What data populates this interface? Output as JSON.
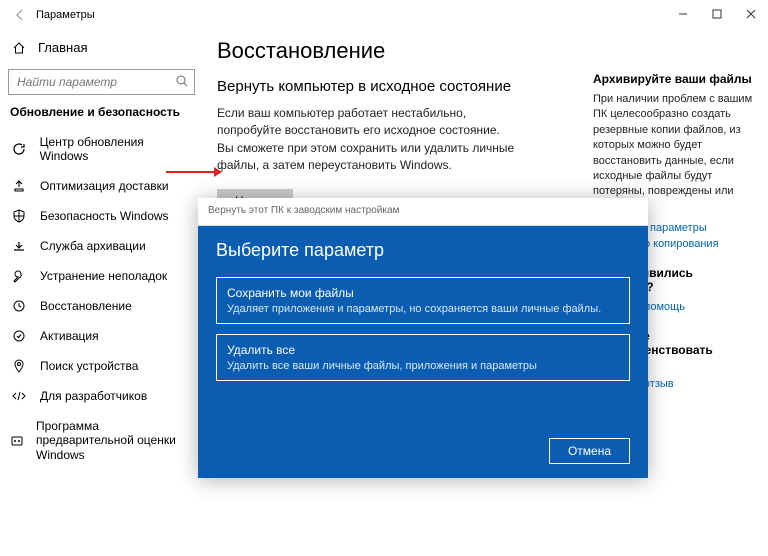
{
  "window": {
    "title": "Параметры"
  },
  "sidebar": {
    "home": "Главная",
    "searchPlaceholder": "Найти параметр",
    "section": "Обновление и безопасность",
    "items": [
      {
        "label": "Центр обновления Windows"
      },
      {
        "label": "Оптимизация доставки"
      },
      {
        "label": "Безопасность Windows"
      },
      {
        "label": "Служба архивации"
      },
      {
        "label": "Устранение неполадок"
      },
      {
        "label": "Восстановление"
      },
      {
        "label": "Активация"
      },
      {
        "label": "Поиск устройства"
      },
      {
        "label": "Для разработчиков"
      },
      {
        "label": "Программа предварительной оценки Windows"
      }
    ]
  },
  "main": {
    "title": "Восстановление",
    "sectionTitle": "Вернуть компьютер в исходное состояние",
    "desc": "Если ваш компьютер работает нестабильно, попробуйте восстановить его исходное состояние. Вы сможете при этом сохранить или удалить личные файлы, а затем переустановить Windows.",
    "startBtn": "Начать"
  },
  "aside": {
    "t1": "Архивируйте ваши файлы",
    "p1": "При наличии проблем с вашим ПК целесообразно создать резервные копии файлов, из которых можно будет восстановить данные, если исходные файлы будут потеряны, повреждены или удалены.",
    "l1": "Проверьте параметры резервного копирования",
    "t2": "У вас появились вопросы?",
    "l2": "Получить помощь",
    "t3": "Помогите усовершенствовать Windows",
    "l3": "Оставить отзыв"
  },
  "dialog": {
    "header": "Вернуть этот ПК к заводским настройкам",
    "title": "Выберите параметр",
    "opt1t": "Сохранить мои файлы",
    "opt1d": "Удаляет приложения и параметры, но сохраняется ваши личные файлы.",
    "opt2t": "Удалить все",
    "opt2d": "Удалить все ваши личные файлы, приложения и параметры",
    "cancel": "Отмена"
  }
}
